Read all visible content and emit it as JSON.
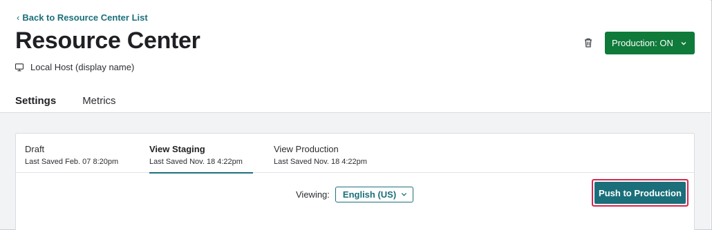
{
  "header": {
    "back_link": "Back to Resource Center List",
    "title": "Resource Center",
    "host_label": "Local Host (display name)",
    "production_button": "Production: ON"
  },
  "tabs": [
    {
      "label": "Settings",
      "active": true
    },
    {
      "label": "Metrics",
      "active": false
    }
  ],
  "versions": [
    {
      "title": "Draft",
      "subtitle": "Last Saved Feb. 07 8:20pm",
      "active": false
    },
    {
      "title": "View Staging",
      "subtitle": "Last Saved Nov. 18 4:22pm",
      "active": true
    },
    {
      "title": "View Production",
      "subtitle": "Last Saved Nov. 18 4:22pm",
      "active": false
    }
  ],
  "viewing": {
    "label": "Viewing:",
    "selected_language": "English (US)"
  },
  "push_button": "Push to Production",
  "colors": {
    "teal_accent": "#1a6f7a",
    "production_green": "#0f7a3a",
    "highlight_red": "#d8234c"
  },
  "icons": {
    "back": "chevron-left-icon",
    "host": "monitor-icon",
    "delete": "trash-icon",
    "dropdown": "chevron-down-icon"
  }
}
